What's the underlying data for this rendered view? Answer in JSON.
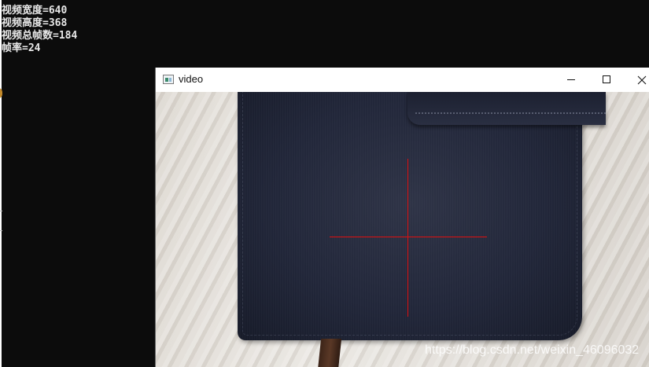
{
  "console": {
    "lines": [
      "视频宽度=640",
      "视频高度=368",
      "视频总帧数=184",
      "帧率=24"
    ]
  },
  "video_window": {
    "title": "video",
    "icon": "opencv-window-icon",
    "controls": {
      "minimize_icon": "minimize-icon",
      "maximize_icon": "maximize-icon",
      "close_icon": "close-icon"
    },
    "frame": {
      "subject": "navy notebook on light wood surface",
      "crosshair_color": "#e01010"
    },
    "watermark": "https://blog.csdn.net/weixin_46096032"
  }
}
